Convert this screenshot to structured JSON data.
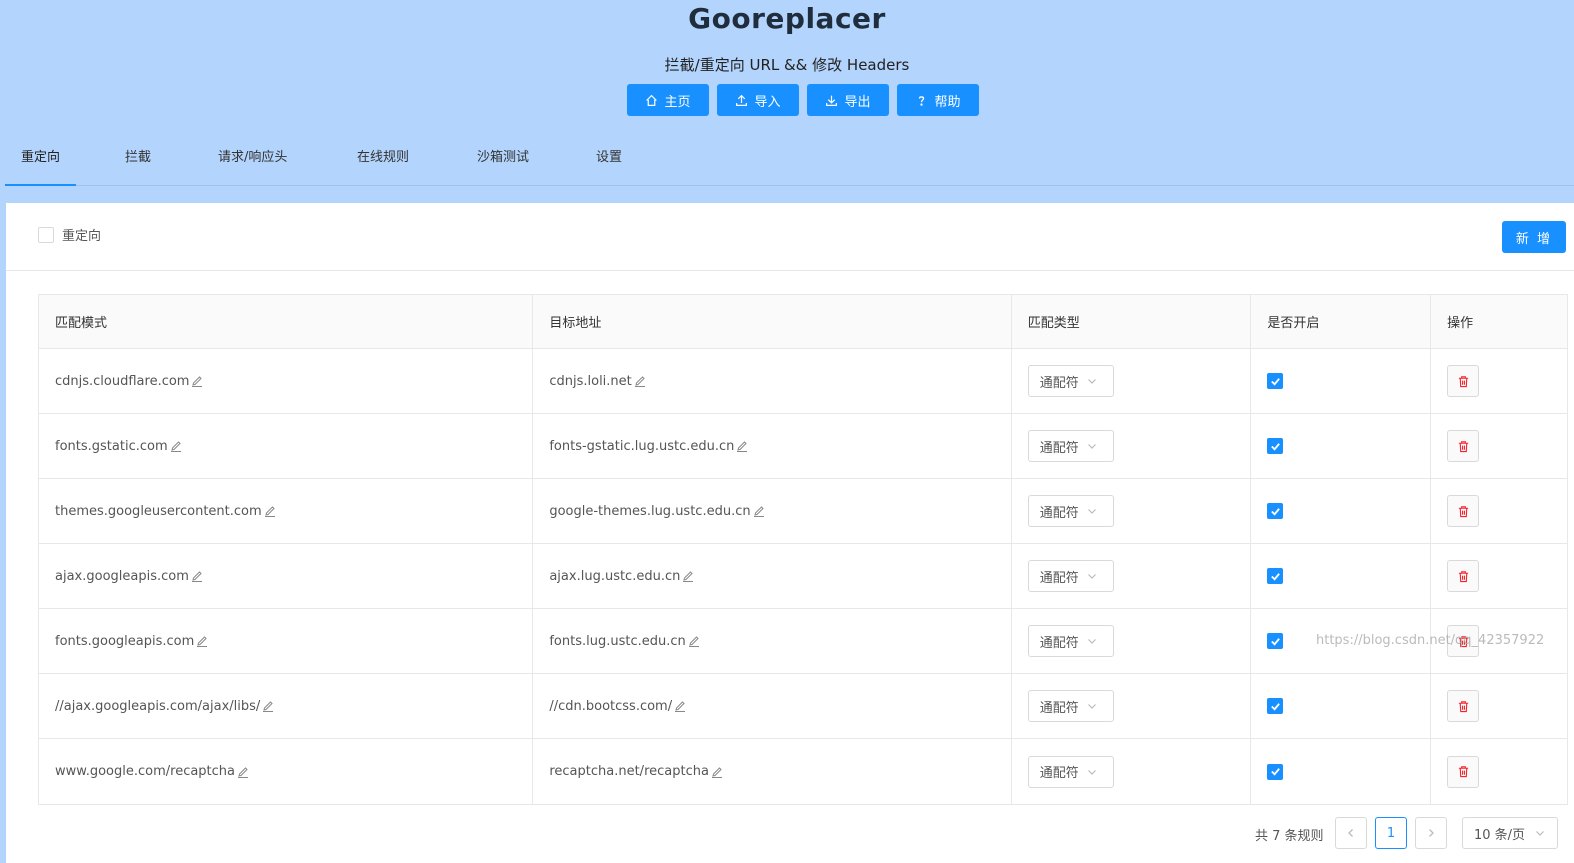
{
  "app": {
    "title": "Gooreplacer",
    "subtitle": "拦截/重定向 URL && 修改 Headers"
  },
  "top_buttons": [
    {
      "label": "主页",
      "icon": "home-icon"
    },
    {
      "label": "导入",
      "icon": "upload-icon"
    },
    {
      "label": "导出",
      "icon": "download-icon"
    },
    {
      "label": "帮助",
      "icon": "question-icon"
    }
  ],
  "tabs": [
    {
      "label": "重定向",
      "active": true
    },
    {
      "label": "拦截",
      "active": false
    },
    {
      "label": "请求/响应头",
      "active": false
    },
    {
      "label": "在线规则",
      "active": false
    },
    {
      "label": "沙箱测试",
      "active": false
    },
    {
      "label": "设置",
      "active": false
    }
  ],
  "panel": {
    "master_checkbox_label": "重定向",
    "new_button": "新 增"
  },
  "table": {
    "headers": [
      "匹配模式",
      "目标地址",
      "匹配类型",
      "是否开启",
      "操作"
    ],
    "rows": [
      {
        "pattern": "cdnjs.cloudflare.com",
        "target": "cdnjs.loli.net",
        "type": "通配符",
        "enabled": true
      },
      {
        "pattern": "fonts.gstatic.com",
        "target": "fonts-gstatic.lug.ustc.edu.cn",
        "type": "通配符",
        "enabled": true
      },
      {
        "pattern": "themes.googleusercontent.com",
        "target": "google-themes.lug.ustc.edu.cn",
        "type": "通配符",
        "enabled": true
      },
      {
        "pattern": "ajax.googleapis.com",
        "target": "ajax.lug.ustc.edu.cn",
        "type": "通配符",
        "enabled": true
      },
      {
        "pattern": "fonts.googleapis.com",
        "target": "fonts.lug.ustc.edu.cn",
        "type": "通配符",
        "enabled": true
      },
      {
        "pattern": "//ajax.googleapis.com/ajax/libs/",
        "target": "//cdn.bootcss.com/",
        "type": "通配符",
        "enabled": true
      },
      {
        "pattern": "www.google.com/recaptcha",
        "target": "recaptcha.net/recaptcha",
        "type": "通配符",
        "enabled": true
      }
    ]
  },
  "pagination": {
    "total_text": "共 7 条规则",
    "current_page": "1",
    "page_size": "10 条/页"
  },
  "watermark": "https://blog.csdn.net/qq_42357922",
  "colors": {
    "header_bg": "#b3d4fc",
    "primary": "#1890ff",
    "delete": "#f5222d"
  }
}
